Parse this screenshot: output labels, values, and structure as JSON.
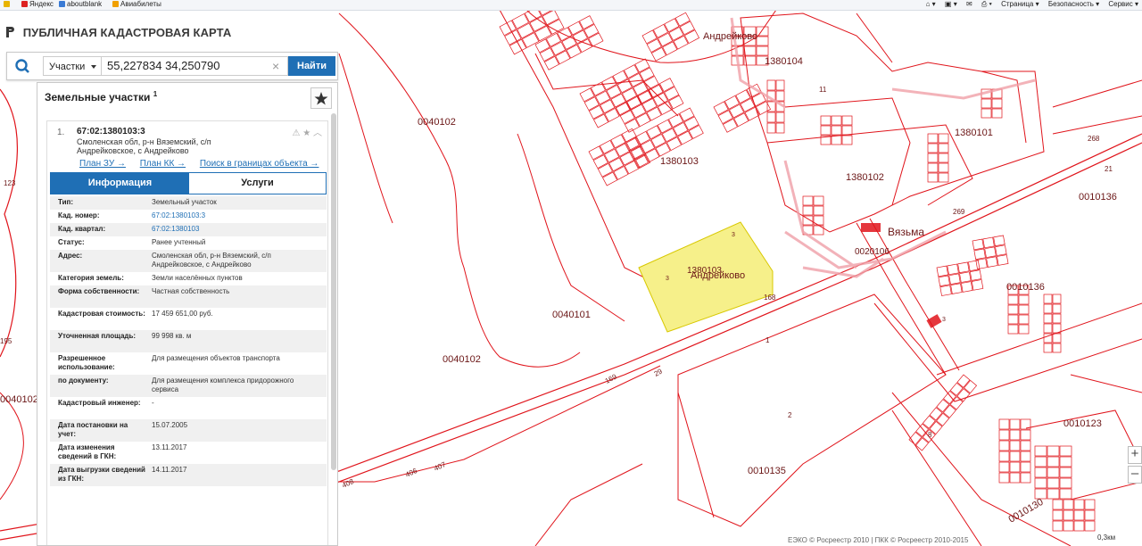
{
  "browser": {
    "favorites": [
      {
        "label": "Яндекс",
        "icon": "yandex-icon"
      },
      {
        "label": "aboutblank",
        "icon": "ie-page-icon"
      },
      {
        "label": "Авиабилеты",
        "icon": "plane-icon"
      }
    ],
    "tools": [
      "Страница ▾",
      "Безопасность ▾",
      "Сервис ▾"
    ]
  },
  "header": {
    "title": "ПУБЛИЧНАЯ КАДАСТРОВАЯ КАРТА"
  },
  "search": {
    "type_label": "Участки",
    "query": "55,227834 34,250790",
    "button_label": "Найти"
  },
  "panel": {
    "title": "Земельные участки",
    "title_sup": "1",
    "result": {
      "index": "1.",
      "cad_number": "67:02:1380103:3",
      "address": "Смоленская обл, р-н Вяземский, с/п Андрейковское, с Андрейково",
      "links": [
        "План ЗУ →",
        "План КК →",
        "Поиск в границах объекта →"
      ],
      "tabs": [
        "Информация",
        "Услуги"
      ],
      "fields": [
        {
          "key": "Тип:",
          "value": "Земельный участок"
        },
        {
          "key": "Кад. номер:",
          "value": "67:02:1380103:3",
          "link": true
        },
        {
          "key": "Кад. квартал:",
          "value": "67:02:1380103",
          "link": true
        },
        {
          "key": "Статус:",
          "value": "Ранее учтенный"
        },
        {
          "key": "Адрес:",
          "value": "Смоленская обл, р-н Вяземский, с/п Андрейковское, с Андрейково"
        },
        {
          "key": "Категория земель:",
          "value": "Земли населённых пунктов"
        },
        {
          "key": "Форма собственности:",
          "value": "Частная собственность"
        },
        {
          "key": "Кадастровая стоимость:",
          "value": "17 459 651,00 руб."
        },
        {
          "key": "Уточненная площадь:",
          "value": "99 998 кв. м"
        },
        {
          "key": "Разрешенное использование:",
          "value": "Для размещения объектов транспорта"
        },
        {
          "key": "по документу:",
          "value": "Для размещения комплекса придорожного сервиса"
        },
        {
          "key": "Кадастровый инженер:",
          "value": "-"
        },
        {
          "key": "Дата постановки на учет:",
          "value": "15.07.2005"
        },
        {
          "key": "Дата изменения сведений в ГКН:",
          "value": "13.11.2017"
        },
        {
          "key": "Дата выгрузки сведений из ГКН:",
          "value": "14.11.2017"
        }
      ]
    }
  },
  "map": {
    "labels": [
      {
        "text": "Андрейково",
        "size": 11
      },
      {
        "text": "1380104",
        "size": 11
      },
      {
        "text": "1380101",
        "size": 11
      },
      {
        "text": "1380103",
        "size": 11
      },
      {
        "text": "1380102",
        "size": 11
      },
      {
        "text": "Вязьма",
        "size": 12
      },
      {
        "text": "0020106",
        "size": 10
      },
      {
        "text": "0010136",
        "size": 11
      },
      {
        "text": "0010136",
        "size": 11
      },
      {
        "text": "0040102",
        "size": 11
      },
      {
        "text": "0040102",
        "size": 11
      },
      {
        "text": "0040102",
        "size": 11
      },
      {
        "text": "0040101",
        "size": 11
      },
      {
        "text": "0010135",
        "size": 11
      },
      {
        "text": "0010123",
        "size": 11
      },
      {
        "text": "0010130",
        "size": 11
      },
      {
        "text": "Андрейково",
        "size": 11
      },
      {
        "text": "1380103",
        "size": 10
      },
      {
        "text": "168",
        "size": 8
      },
      {
        "text": "169",
        "size": 8
      },
      {
        "text": "29",
        "size": 8
      },
      {
        "text": "1",
        "size": 8
      },
      {
        "text": "2",
        "size": 8
      },
      {
        "text": "8",
        "size": 8
      },
      {
        "text": "11",
        "size": 8
      },
      {
        "text": "268",
        "size": 8
      },
      {
        "text": "21",
        "size": 8
      },
      {
        "text": "269",
        "size": 8
      },
      {
        "text": "123",
        "size": 8
      },
      {
        "text": "195",
        "size": 8
      },
      {
        "text": "406",
        "size": 8
      },
      {
        "text": "407",
        "size": 8
      },
      {
        "text": "408",
        "size": 8
      },
      {
        "text": "104",
        "size": 8
      },
      {
        "text": "410",
        "size": 8
      },
      {
        "text": "3",
        "size": 7
      },
      {
        "text": "3",
        "size": 7
      },
      {
        "text": "3",
        "size": 7
      }
    ],
    "highlight_color": "#f6f08a",
    "boundary_color": "#e0141b",
    "footer": "ЕЭКО © Росреестр 2010 | ПКК © Росреестр 2010-2015",
    "scale": "0,3км"
  },
  "zoom": [
    "+",
    "–"
  ]
}
